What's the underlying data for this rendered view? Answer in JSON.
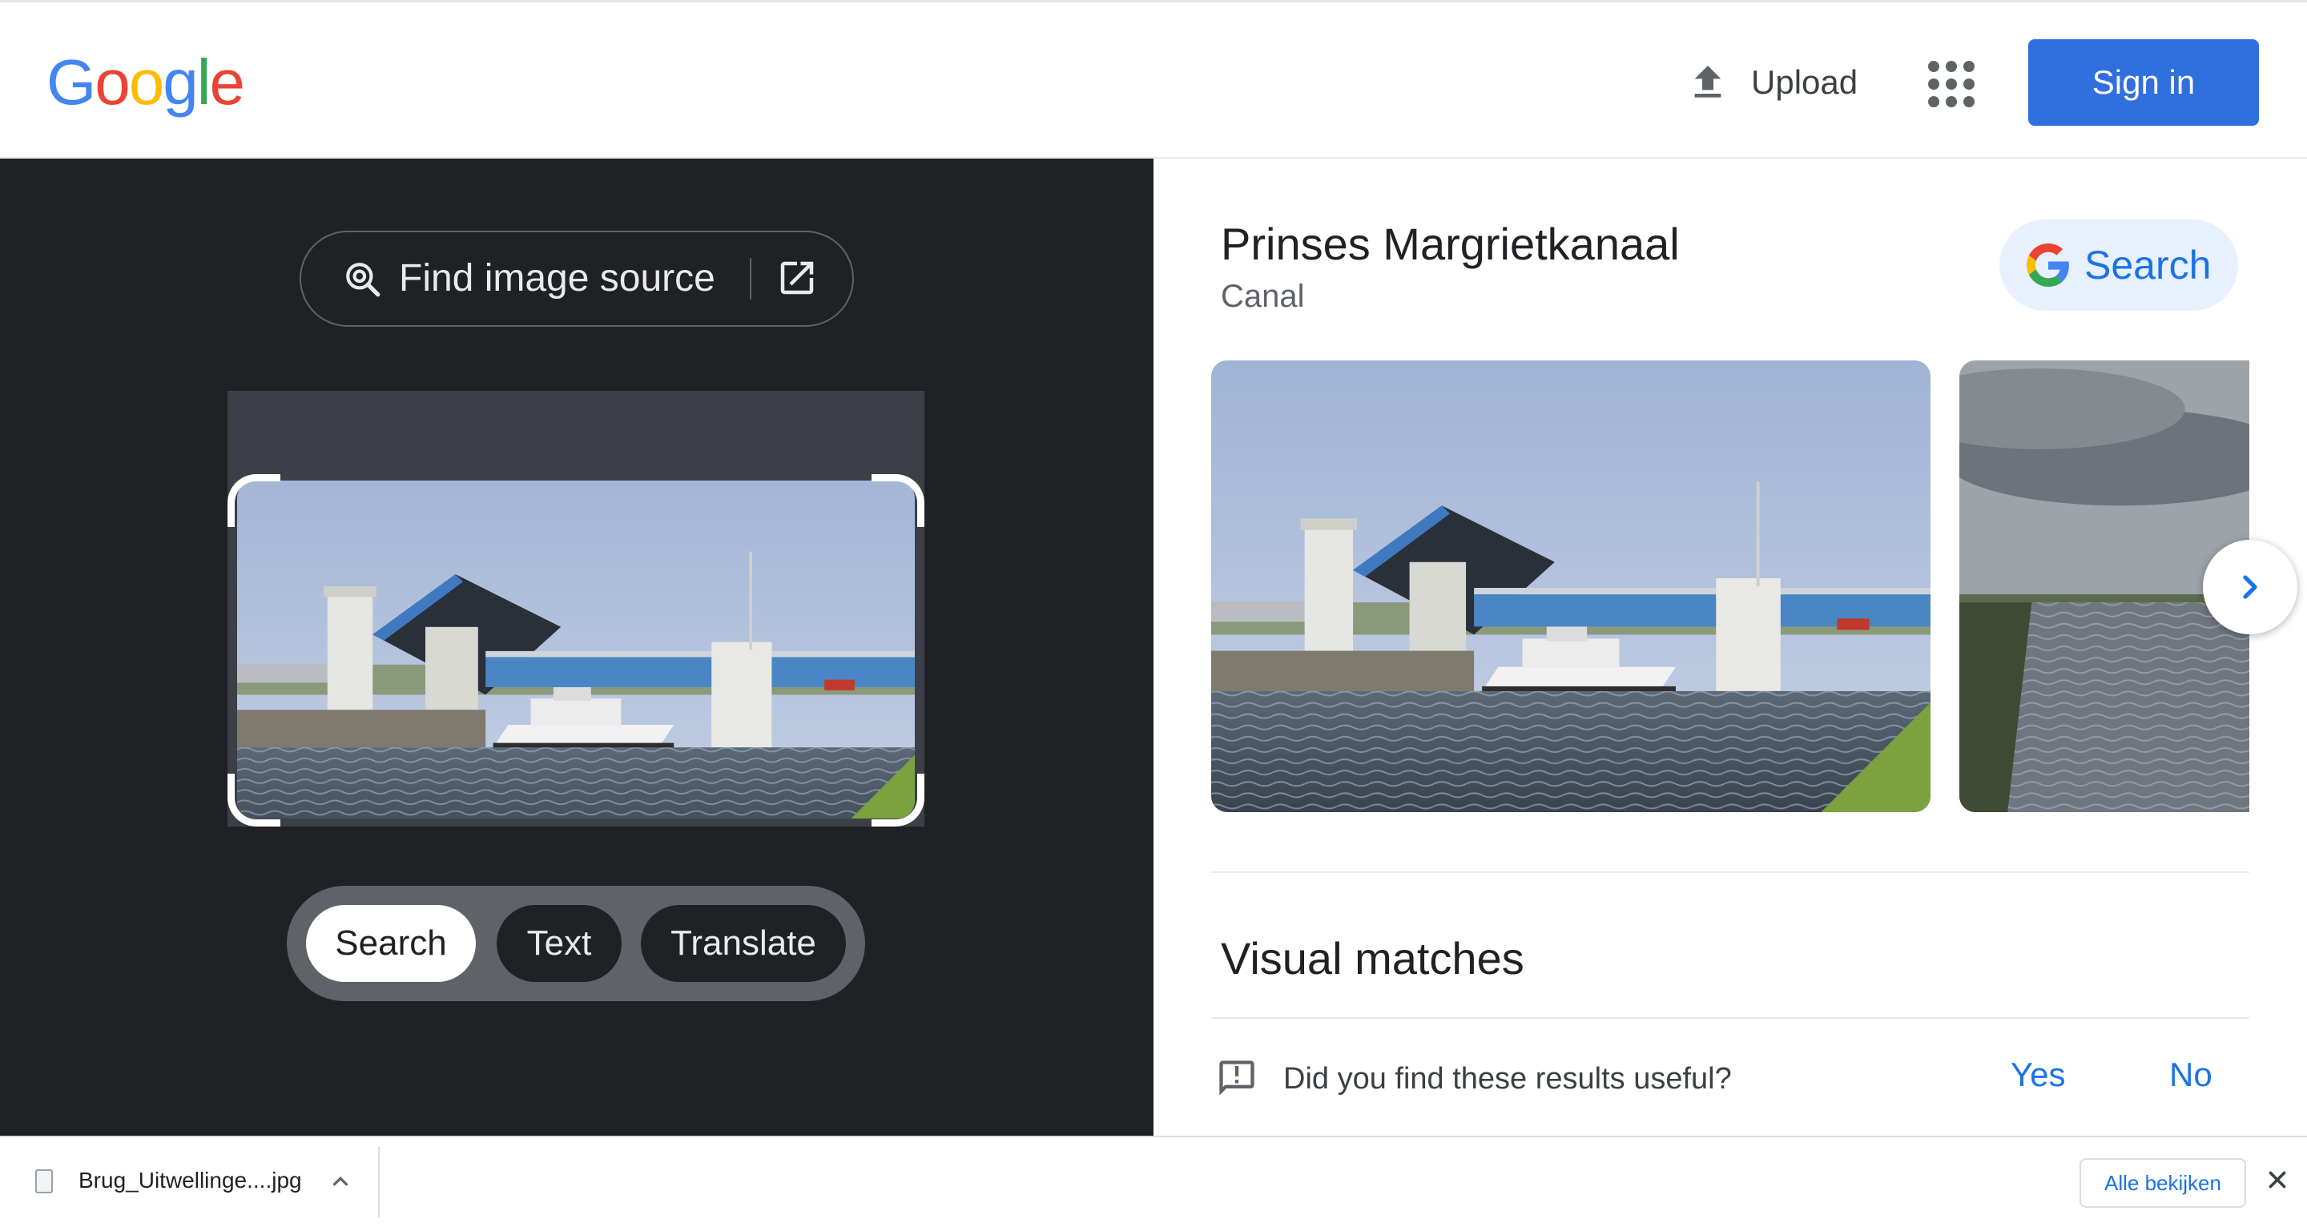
{
  "header": {
    "logo_letters": [
      {
        "ch": "G",
        "color": "#4285F4"
      },
      {
        "ch": "o",
        "color": "#EA4335"
      },
      {
        "ch": "o",
        "color": "#FBBC05"
      },
      {
        "ch": "g",
        "color": "#4285F4"
      },
      {
        "ch": "l",
        "color": "#34A853"
      },
      {
        "ch": "e",
        "color": "#EA4335"
      }
    ],
    "upload_label": "Upload",
    "upload_icon": "upload-icon",
    "apps_icon": "apps-grid-icon",
    "signin_label": "Sign in",
    "signin_color": "#2f6fde"
  },
  "left_pane": {
    "find_source_label": "Find image source",
    "find_source_icon": "lens-search-icon",
    "open_external_icon": "open-in-new-icon",
    "modes": [
      {
        "label": "Search",
        "active": true
      },
      {
        "label": "Text",
        "active": false
      },
      {
        "label": "Translate",
        "active": false
      }
    ]
  },
  "right_pane": {
    "entity_title": "Prinses Margrietkanaal",
    "entity_subtitle": "Canal",
    "search_button_label": "Search",
    "next_icon": "chevron-right-icon",
    "visual_matches_title": "Visual matches",
    "feedback": {
      "question": "Did you find these results useful?",
      "yes": "Yes",
      "no": "No",
      "icon": "feedback-icon"
    }
  },
  "download_bar": {
    "filename": "Brug_Uitwellinge....jpg",
    "view_all_label": "Alle bekijken",
    "chevron_icon": "chevron-up-icon",
    "close_icon": "close-icon"
  },
  "colors": {
    "left_bg": "#202124",
    "accent_blue": "#1a73e8"
  }
}
